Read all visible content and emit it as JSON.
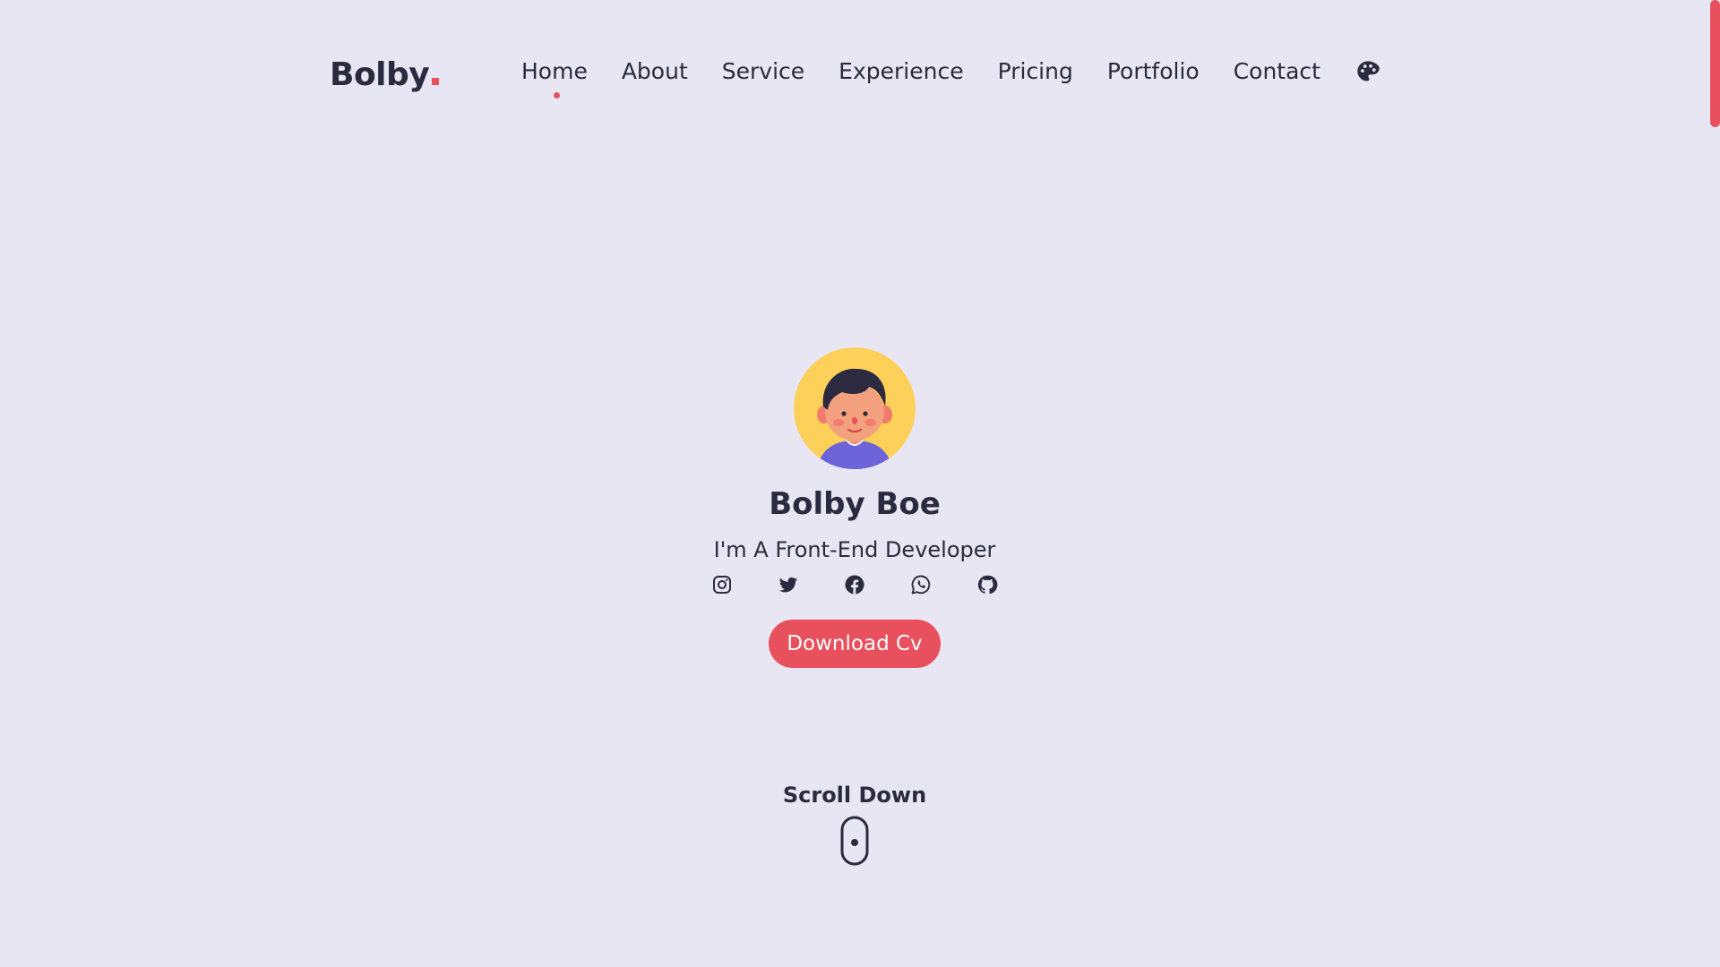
{
  "brand": {
    "name": "Bolby",
    "accent_color": "#e9505d",
    "text_color": "#2b2a3f",
    "background_color": "#e8e6f2"
  },
  "nav": {
    "items": [
      {
        "label": "Home",
        "active": true
      },
      {
        "label": "About",
        "active": false
      },
      {
        "label": "Service",
        "active": false
      },
      {
        "label": "Experience",
        "active": false
      },
      {
        "label": "Pricing",
        "active": false
      },
      {
        "label": "Portfolio",
        "active": false
      },
      {
        "label": "Contact",
        "active": false
      }
    ],
    "theme_icon": "palette-icon"
  },
  "hero": {
    "avatar_icon": "avatar-illustration",
    "name": "Bolby Boe",
    "tagline": "I'm A Front-End Developer",
    "socials": [
      "instagram-icon",
      "twitter-icon",
      "facebook-icon",
      "whatsapp-icon",
      "github-icon"
    ],
    "cta_label": "Download Cv"
  },
  "scroll": {
    "label": "Scroll Down",
    "icon": "mouse-icon"
  }
}
